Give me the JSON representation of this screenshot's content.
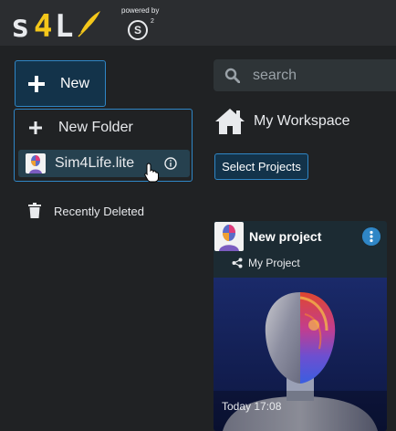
{
  "header": {
    "logo_text": "s4L",
    "powered_by": "powered by",
    "s_logo": "S",
    "s_logo_sup": "2"
  },
  "sidebar": {
    "new_button": "New",
    "menu": [
      {
        "label": "New Folder",
        "icon": "plus-icon"
      },
      {
        "label": "Sim4Life.lite",
        "icon": "sim4life-icon",
        "trailing_icon": "info-icon"
      }
    ],
    "recently_deleted": "Recently Deleted"
  },
  "main": {
    "search_placeholder": "search",
    "workspace_label": "My Workspace",
    "select_projects": "Select Projects",
    "card": {
      "title": "New project",
      "shared_with": "My Project",
      "modified": "Today 17:08"
    }
  },
  "colors": {
    "accent": "#2f86c6",
    "logo_yellow": "#f4c71a",
    "background": "#202224",
    "topbar": "#2b2d30"
  }
}
